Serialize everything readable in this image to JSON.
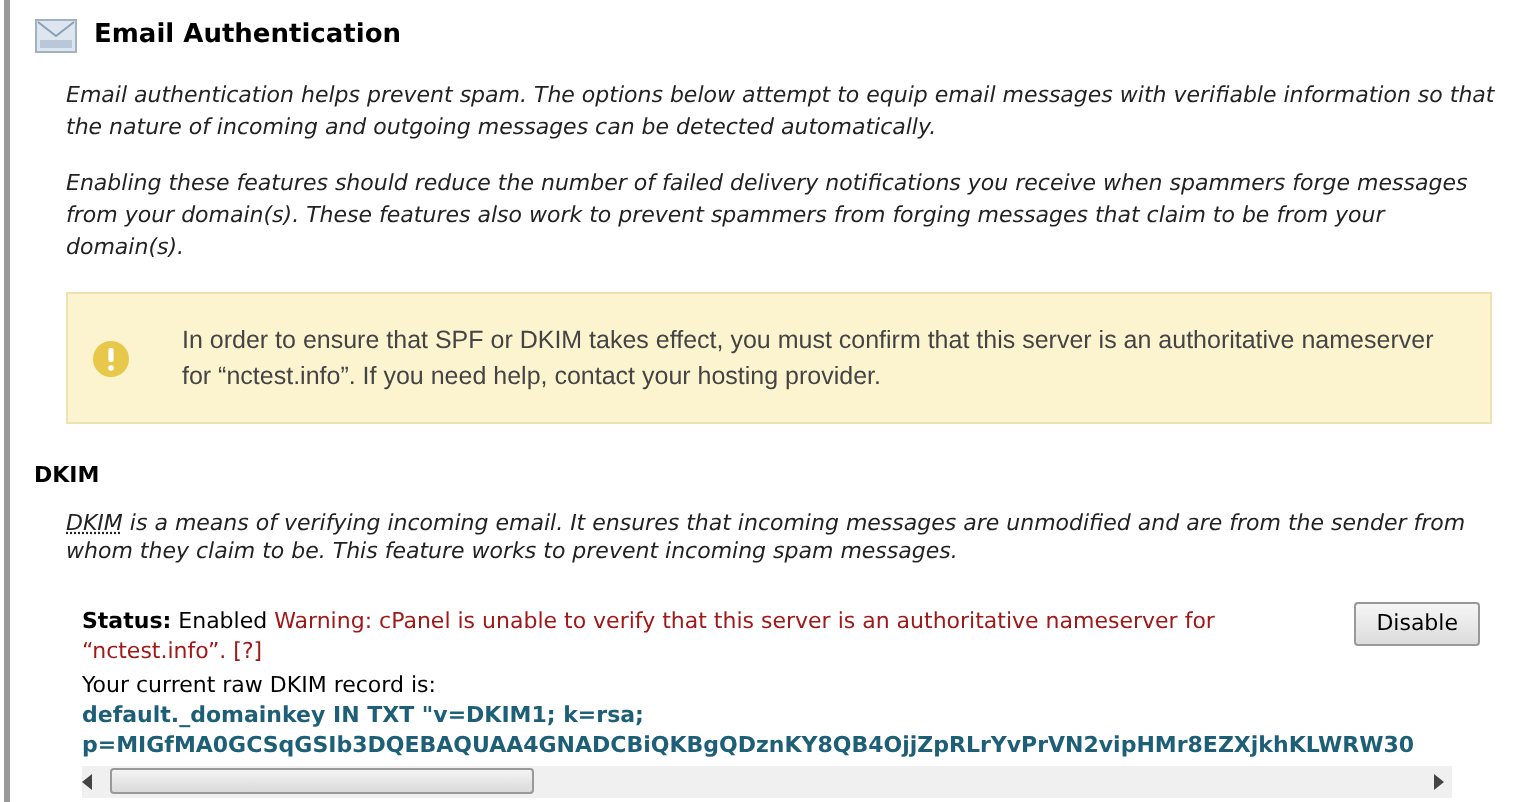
{
  "title": "Email Authentication",
  "intro": [
    "Email authentication helps prevent spam. The options below attempt to equip email messages with verifiable information so that the nature of incoming and outgoing messages can be detected automatically.",
    "Enabling these features should reduce the number of failed delivery notifications you receive when spammers forge messages from your domain(s). These features also work to prevent spammers from forging messages that claim to be from your domain(s)."
  ],
  "alert": {
    "kind": "warning",
    "text": "In order to ensure that SPF or DKIM takes effect, you must confirm that this server is an authoritative nameserver for “nctest.info”. If you need help, contact your hosting provider."
  },
  "dkim": {
    "heading": "DKIM",
    "term": "DKIM",
    "description": " is a means of verifying incoming email. It ensures that incoming messages are unmodified and are from the sender from whom they claim to be. This feature works to prevent incoming spam messages.",
    "status_label": "Status:",
    "status_value": "Enabled",
    "warning": "Warning: cPanel is unable to verify that this server is an authoritative nameserver for “nctest.info”.",
    "help_link": "[?]",
    "button": "Disable",
    "record_label": "Your current raw DKIM record is:",
    "record_lines": [
      "default._domainkey IN TXT \"v=DKIM1; k=rsa;",
      "p=MIGfMA0GCSqGSIb3DQEBAQUAA4GNADCBiQKBgQDznKY8QB4OjjZpRLrYvPrVN2vipHMr8EZXjkhKLWRW30"
    ]
  }
}
